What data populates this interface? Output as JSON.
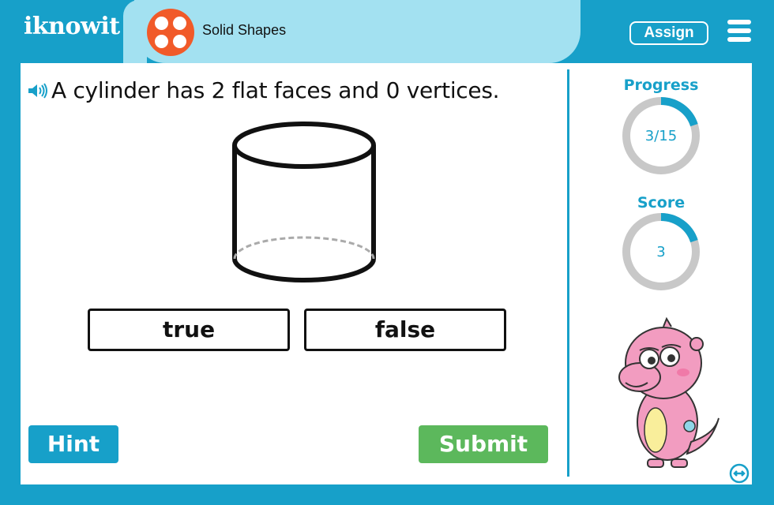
{
  "app": {
    "logo_text": "iknowit",
    "topic_title": "Solid Shapes"
  },
  "header": {
    "assign_label": "Assign",
    "menu_icon": "hamburger-menu-icon"
  },
  "question": {
    "audio_icon": "speaker-icon",
    "text": "A cylinder has 2 flat faces and 0 vertices.",
    "figure": "cylinder"
  },
  "answers": [
    {
      "label": "true"
    },
    {
      "label": "false"
    }
  ],
  "buttons": {
    "hint_label": "Hint",
    "submit_label": "Submit"
  },
  "sidebar": {
    "progress": {
      "label": "Progress",
      "text": "3/15",
      "value": 3,
      "total": 15
    },
    "score": {
      "label": "Score",
      "text": "3",
      "value": 3,
      "fraction": 0.2
    },
    "mascot": "pink-monster",
    "expand_icon": "expand-arrows-icon"
  },
  "colors": {
    "brand": "#17a0c9",
    "pill": "#a3e1f1",
    "topic_icon": "#f15a29",
    "submit": "#5cb85c",
    "ring_track": "#c8c8c8"
  }
}
